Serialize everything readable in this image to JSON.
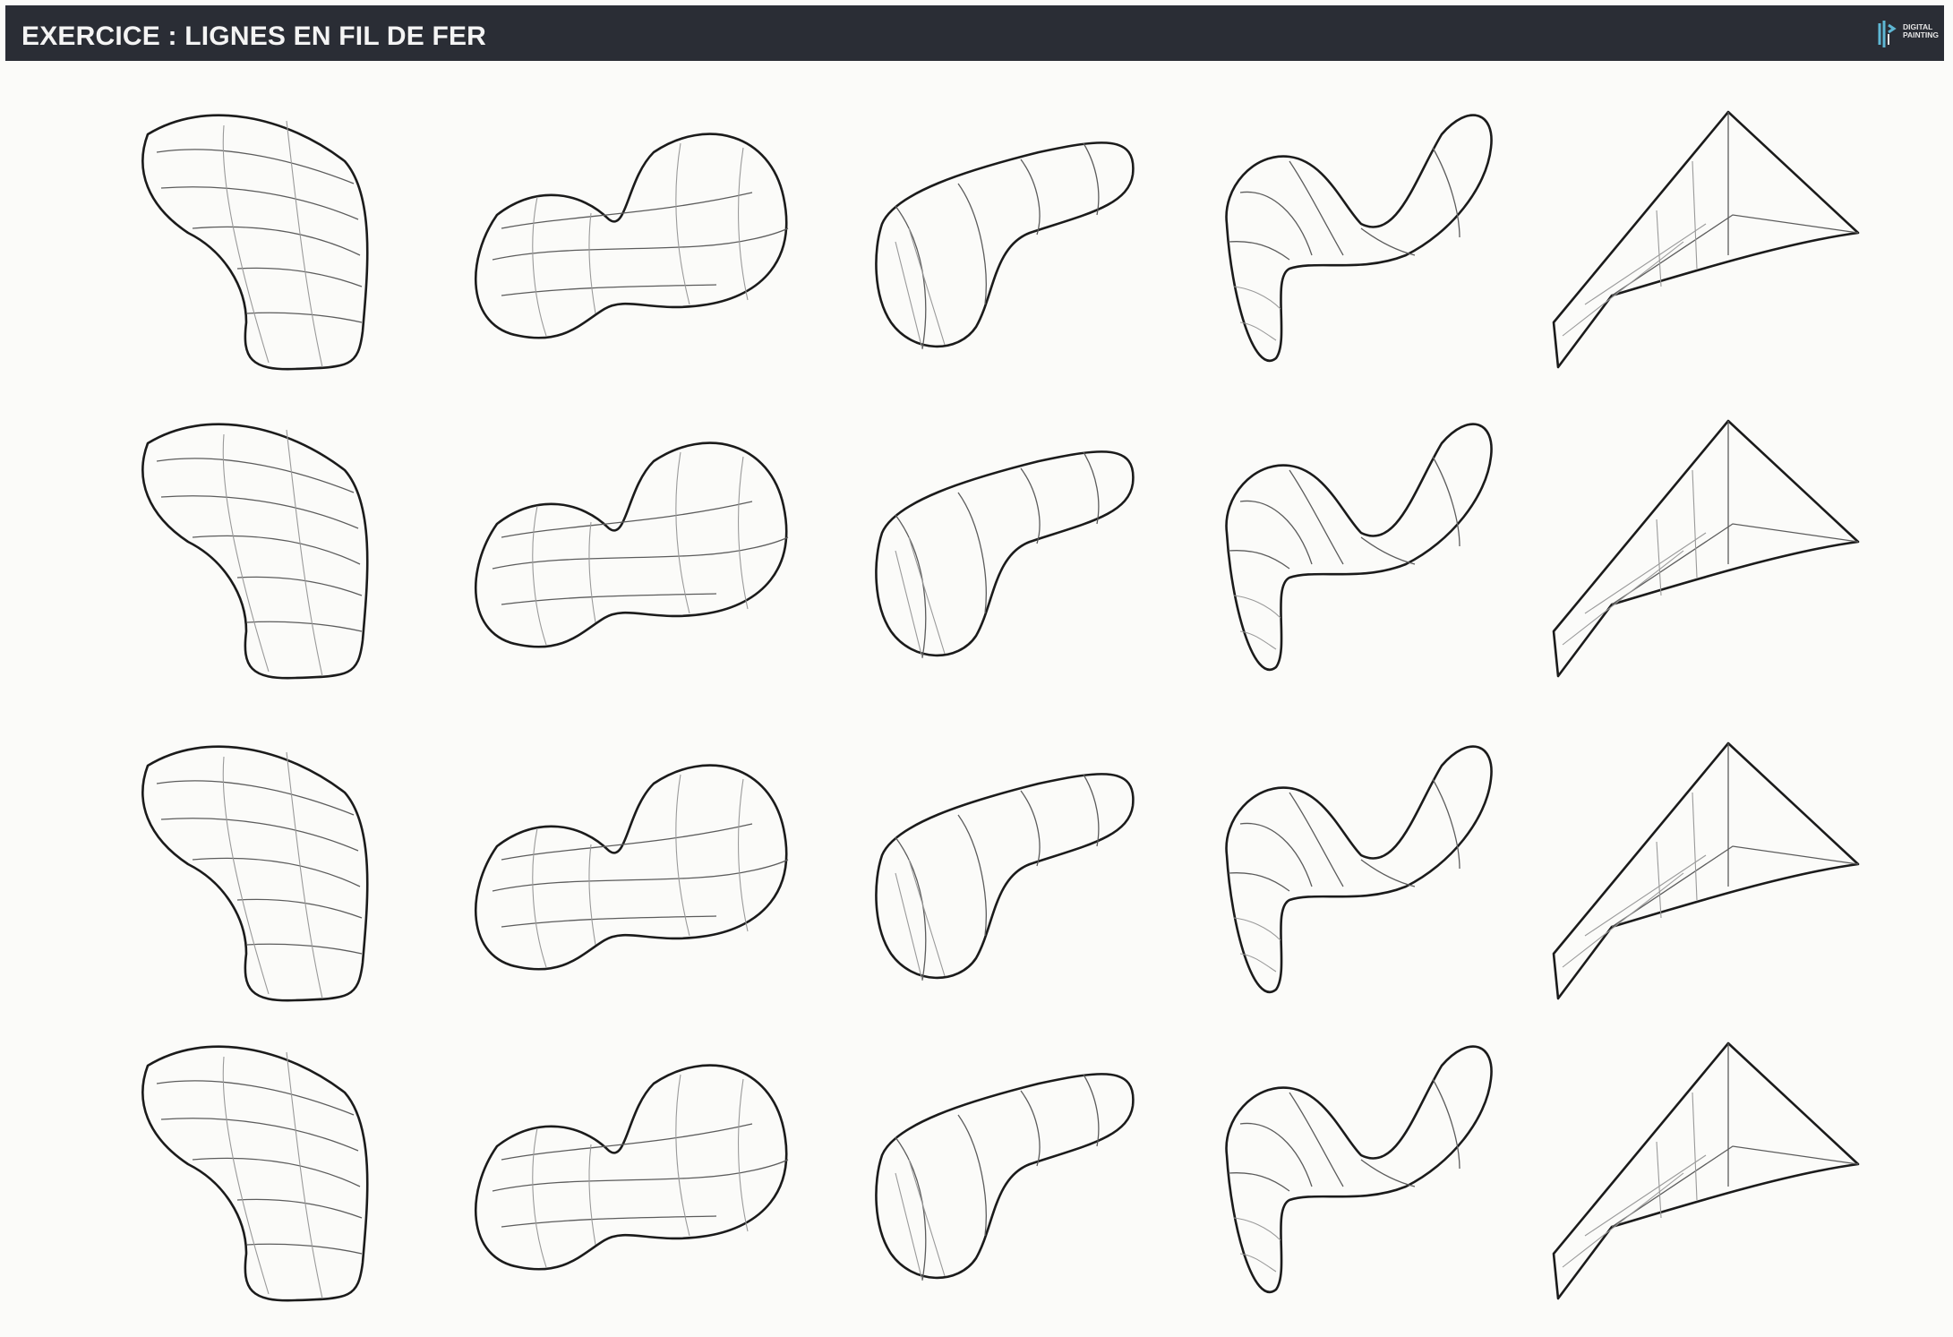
{
  "header": {
    "title": "EXERCICE : LIGNES EN FIL DE FER",
    "logo_text": "DIGITAL\nPAINTING",
    "background": "#2a2d35",
    "text_color": "#f4f4f4"
  },
  "sheet": {
    "rows": 4,
    "columns": 5,
    "shapes": [
      "curved-blob-icon",
      "dumbbell-blob-icon",
      "capsule-blob-icon",
      "s-curve-blob-icon",
      "wedge-shape-icon"
    ]
  }
}
